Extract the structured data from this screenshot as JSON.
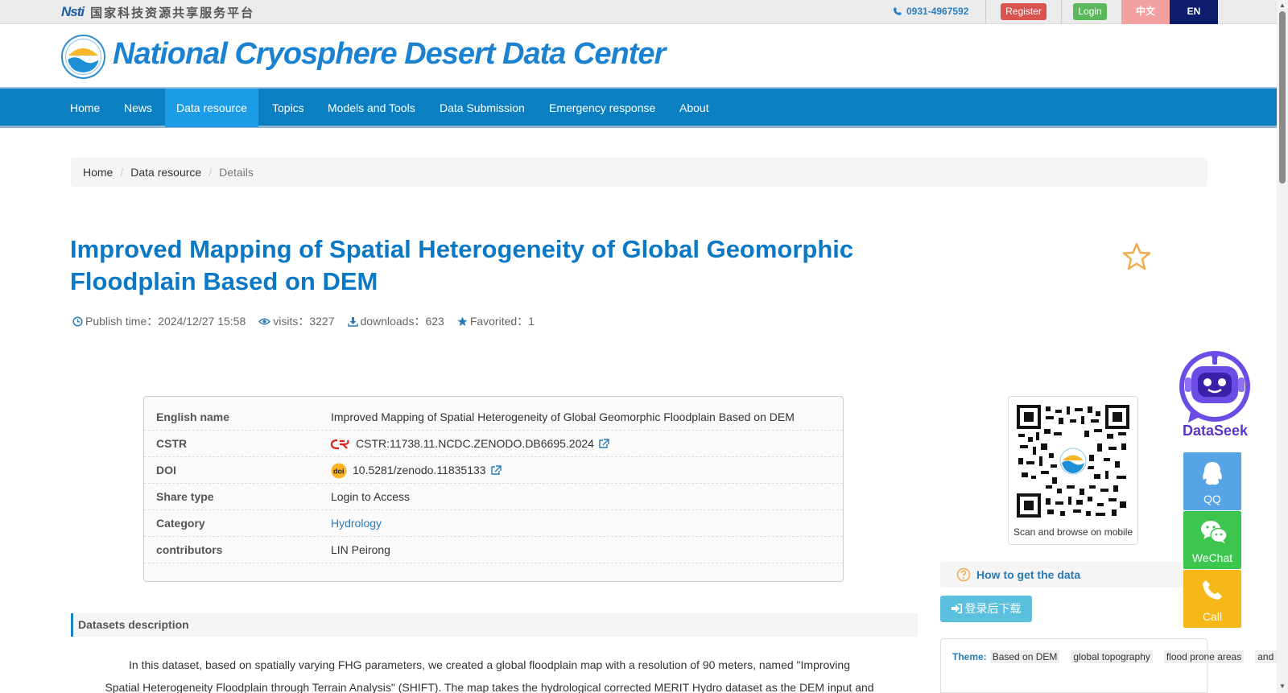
{
  "topbar": {
    "nsti_mark": "Nsti",
    "nsti_text": "国家科技资源共享服务平台",
    "phone": "0931-4967592",
    "register": "Register",
    "login": "Login",
    "lang_zh": "中文",
    "lang_en": "EN"
  },
  "header": {
    "site_title": "National Cryosphere Desert Data Center"
  },
  "nav": {
    "items": [
      "Home",
      "News",
      "Data resource",
      "Topics",
      "Models and Tools",
      "Data Submission",
      "Emergency response",
      "About"
    ],
    "active": "Data resource"
  },
  "breadcrumb": {
    "home": "Home",
    "section": "Data resource",
    "current": "Details"
  },
  "dataset": {
    "title": "Improved Mapping of Spatial Heterogeneity of Global Geomorphic Floodplain Based on DEM",
    "publish_time": "Publish time：2024/12/27 15:58",
    "visits": "visits：3227",
    "downloads": "downloads：623",
    "favorited": "Favorited：1"
  },
  "info": {
    "english_name_label": "English name",
    "english_name": "Improved Mapping of Spatial Heterogeneity of Global Geomorphic Floodplain Based on DEM",
    "cstr_label": "CSTR",
    "cstr": "CSTR:11738.11.NCDC.ZENODO.DB6695.2024",
    "doi_label": "DOI",
    "doi": "10.5281/zenodo.11835133",
    "share_type_label": "Share type",
    "share_type": "Login to Access",
    "category_label": "Category",
    "category": "Hydrology",
    "contributors_label": "contributors",
    "contributors": "LIN Peirong"
  },
  "description": {
    "heading": "Datasets description",
    "line1": "In this dataset, based on spatially varying FHG parameters, we created a global floodplain map with a resolution of 90 meters, named \"Improving",
    "line2": "Spatial Heterogeneity Floodplain through Terrain Analysis\" (SHIFT). The map takes the hydrological corrected MERIT Hydro dataset as the DEM input and"
  },
  "sidebar": {
    "qr_caption": "Scan and browse on mobile",
    "how_to": "How to get the data",
    "download_btn": "登录后下载",
    "theme_label": "Theme:",
    "themes": [
      "Based on DEM",
      "global topography",
      "flood prone areas",
      "and spatial heterogeneity"
    ]
  },
  "floating": {
    "dataseek": "DataSeek",
    "qq": "QQ",
    "wechat": "WeChat",
    "call": "Call"
  },
  "colors": {
    "primary": "#0a80c2",
    "title": "#0a78c5",
    "register": "#d9534f",
    "login": "#5cb85c"
  }
}
